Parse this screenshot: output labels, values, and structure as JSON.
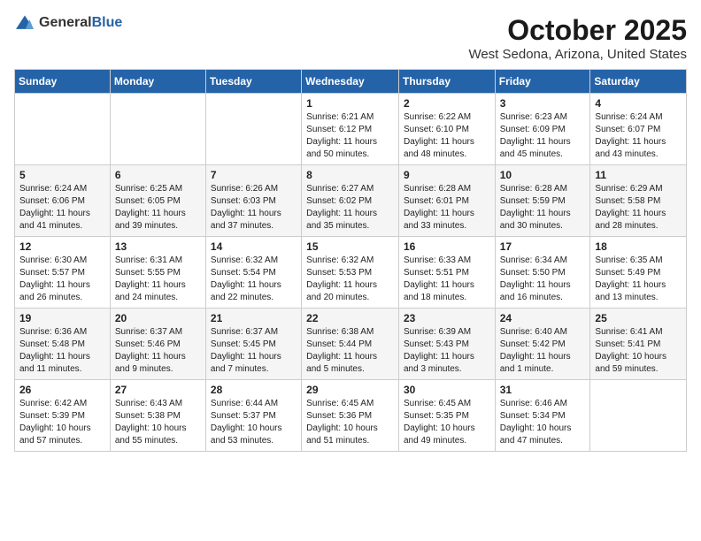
{
  "logo": {
    "general": "General",
    "blue": "Blue"
  },
  "header": {
    "month": "October 2025",
    "location": "West Sedona, Arizona, United States"
  },
  "days_of_week": [
    "Sunday",
    "Monday",
    "Tuesday",
    "Wednesday",
    "Thursday",
    "Friday",
    "Saturday"
  ],
  "weeks": [
    [
      {
        "day": "",
        "info": ""
      },
      {
        "day": "",
        "info": ""
      },
      {
        "day": "",
        "info": ""
      },
      {
        "day": "1",
        "info": "Sunrise: 6:21 AM\nSunset: 6:12 PM\nDaylight: 11 hours\nand 50 minutes."
      },
      {
        "day": "2",
        "info": "Sunrise: 6:22 AM\nSunset: 6:10 PM\nDaylight: 11 hours\nand 48 minutes."
      },
      {
        "day": "3",
        "info": "Sunrise: 6:23 AM\nSunset: 6:09 PM\nDaylight: 11 hours\nand 45 minutes."
      },
      {
        "day": "4",
        "info": "Sunrise: 6:24 AM\nSunset: 6:07 PM\nDaylight: 11 hours\nand 43 minutes."
      }
    ],
    [
      {
        "day": "5",
        "info": "Sunrise: 6:24 AM\nSunset: 6:06 PM\nDaylight: 11 hours\nand 41 minutes."
      },
      {
        "day": "6",
        "info": "Sunrise: 6:25 AM\nSunset: 6:05 PM\nDaylight: 11 hours\nand 39 minutes."
      },
      {
        "day": "7",
        "info": "Sunrise: 6:26 AM\nSunset: 6:03 PM\nDaylight: 11 hours\nand 37 minutes."
      },
      {
        "day": "8",
        "info": "Sunrise: 6:27 AM\nSunset: 6:02 PM\nDaylight: 11 hours\nand 35 minutes."
      },
      {
        "day": "9",
        "info": "Sunrise: 6:28 AM\nSunset: 6:01 PM\nDaylight: 11 hours\nand 33 minutes."
      },
      {
        "day": "10",
        "info": "Sunrise: 6:28 AM\nSunset: 5:59 PM\nDaylight: 11 hours\nand 30 minutes."
      },
      {
        "day": "11",
        "info": "Sunrise: 6:29 AM\nSunset: 5:58 PM\nDaylight: 11 hours\nand 28 minutes."
      }
    ],
    [
      {
        "day": "12",
        "info": "Sunrise: 6:30 AM\nSunset: 5:57 PM\nDaylight: 11 hours\nand 26 minutes."
      },
      {
        "day": "13",
        "info": "Sunrise: 6:31 AM\nSunset: 5:55 PM\nDaylight: 11 hours\nand 24 minutes."
      },
      {
        "day": "14",
        "info": "Sunrise: 6:32 AM\nSunset: 5:54 PM\nDaylight: 11 hours\nand 22 minutes."
      },
      {
        "day": "15",
        "info": "Sunrise: 6:32 AM\nSunset: 5:53 PM\nDaylight: 11 hours\nand 20 minutes."
      },
      {
        "day": "16",
        "info": "Sunrise: 6:33 AM\nSunset: 5:51 PM\nDaylight: 11 hours\nand 18 minutes."
      },
      {
        "day": "17",
        "info": "Sunrise: 6:34 AM\nSunset: 5:50 PM\nDaylight: 11 hours\nand 16 minutes."
      },
      {
        "day": "18",
        "info": "Sunrise: 6:35 AM\nSunset: 5:49 PM\nDaylight: 11 hours\nand 13 minutes."
      }
    ],
    [
      {
        "day": "19",
        "info": "Sunrise: 6:36 AM\nSunset: 5:48 PM\nDaylight: 11 hours\nand 11 minutes."
      },
      {
        "day": "20",
        "info": "Sunrise: 6:37 AM\nSunset: 5:46 PM\nDaylight: 11 hours\nand 9 minutes."
      },
      {
        "day": "21",
        "info": "Sunrise: 6:37 AM\nSunset: 5:45 PM\nDaylight: 11 hours\nand 7 minutes."
      },
      {
        "day": "22",
        "info": "Sunrise: 6:38 AM\nSunset: 5:44 PM\nDaylight: 11 hours\nand 5 minutes."
      },
      {
        "day": "23",
        "info": "Sunrise: 6:39 AM\nSunset: 5:43 PM\nDaylight: 11 hours\nand 3 minutes."
      },
      {
        "day": "24",
        "info": "Sunrise: 6:40 AM\nSunset: 5:42 PM\nDaylight: 11 hours\nand 1 minute."
      },
      {
        "day": "25",
        "info": "Sunrise: 6:41 AM\nSunset: 5:41 PM\nDaylight: 10 hours\nand 59 minutes."
      }
    ],
    [
      {
        "day": "26",
        "info": "Sunrise: 6:42 AM\nSunset: 5:39 PM\nDaylight: 10 hours\nand 57 minutes."
      },
      {
        "day": "27",
        "info": "Sunrise: 6:43 AM\nSunset: 5:38 PM\nDaylight: 10 hours\nand 55 minutes."
      },
      {
        "day": "28",
        "info": "Sunrise: 6:44 AM\nSunset: 5:37 PM\nDaylight: 10 hours\nand 53 minutes."
      },
      {
        "day": "29",
        "info": "Sunrise: 6:45 AM\nSunset: 5:36 PM\nDaylight: 10 hours\nand 51 minutes."
      },
      {
        "day": "30",
        "info": "Sunrise: 6:45 AM\nSunset: 5:35 PM\nDaylight: 10 hours\nand 49 minutes."
      },
      {
        "day": "31",
        "info": "Sunrise: 6:46 AM\nSunset: 5:34 PM\nDaylight: 10 hours\nand 47 minutes."
      },
      {
        "day": "",
        "info": ""
      }
    ]
  ]
}
